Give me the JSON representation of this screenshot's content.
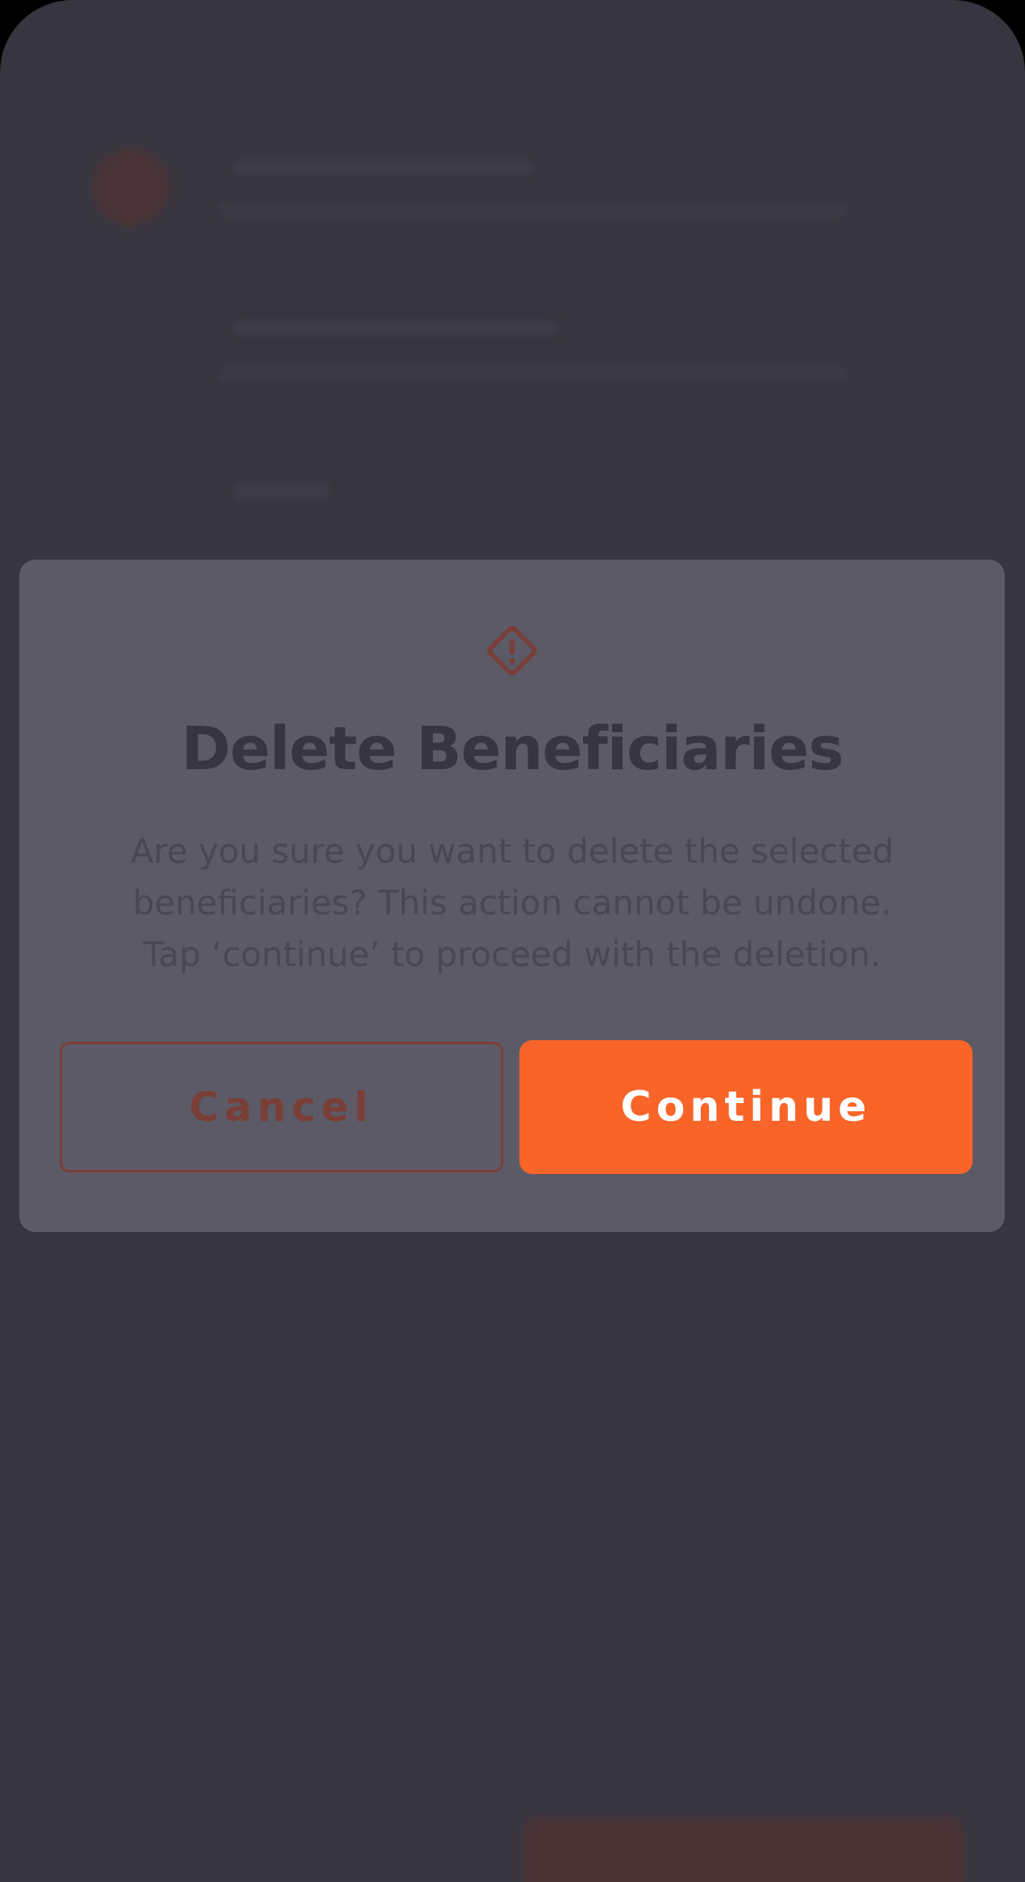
{
  "dialog": {
    "title": "Delete Beneficiaries",
    "message_lines": [
      "Are you sure you want to delete the selected",
      "beneficiaries? This action cannot be undone.",
      "Tap ‘continue’ to proceed with the deletion."
    ],
    "icon": "warning-diamond-icon",
    "cancel_label": "Cancel",
    "continue_label": "Continue"
  },
  "colors": {
    "accent": "#f96428",
    "overlay_background": "#373640",
    "dialog_background": "#5b5a66",
    "cancel_border": "#7a3e36"
  }
}
